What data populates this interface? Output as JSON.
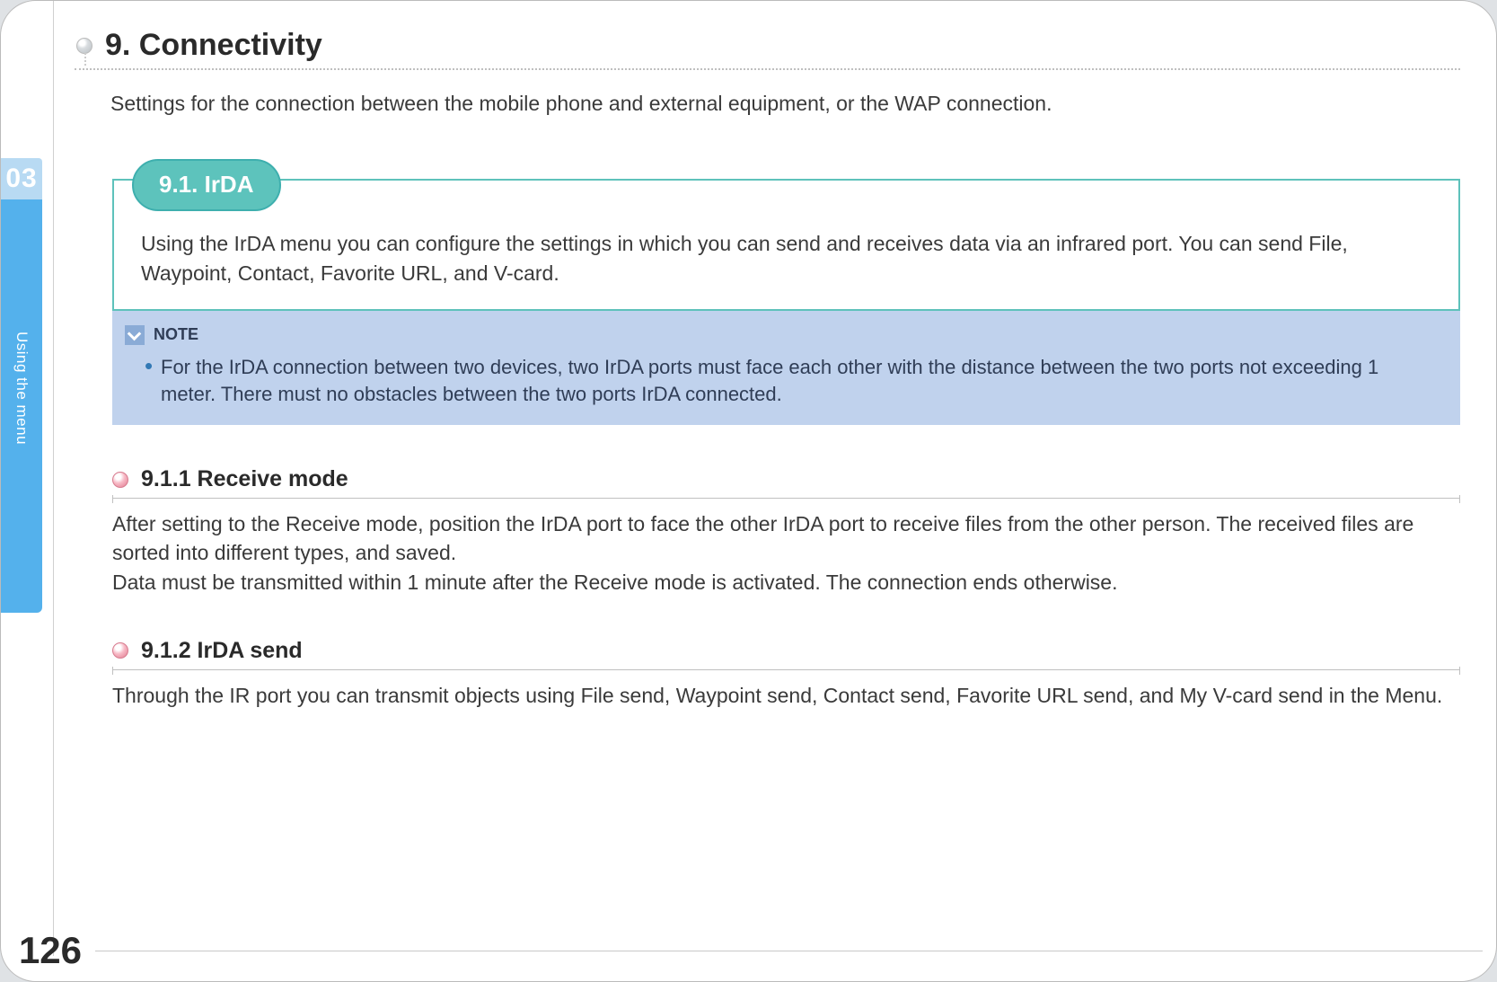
{
  "sidebar": {
    "chapter_number": "03",
    "section_label": "Using the menu"
  },
  "page_number": "126",
  "chapter": {
    "title": "9. Connectivity",
    "intro": "Settings for the connection between the mobile phone and external equipment, or the WAP connection."
  },
  "section_91": {
    "title": "9.1. IrDA",
    "body": "Using the IrDA menu you can configure the settings in which you can send and receives data via an infrared port. You can send File, Waypoint, Contact, Favorite URL, and V-card."
  },
  "note": {
    "label": "NOTE",
    "body": "For the IrDA connection between two devices, two IrDA ports must face each other with the distance between the two ports not exceeding 1 meter. There must no obstacles between the two ports IrDA connected."
  },
  "section_911": {
    "title": "9.1.1 Receive mode",
    "body": "After setting to the Receive mode, position the IrDA port to face the other IrDA port to receive files from the other person. The received files are sorted into different types, and saved.\nData must be transmitted within 1 minute after the Receive mode is activated. The connection ends otherwise."
  },
  "section_912": {
    "title": "9.1.2 IrDA send",
    "body": "Through the IR port you can transmit objects using File send, Waypoint send, Contact send, Favorite URL send, and My V-card send in the Menu."
  }
}
